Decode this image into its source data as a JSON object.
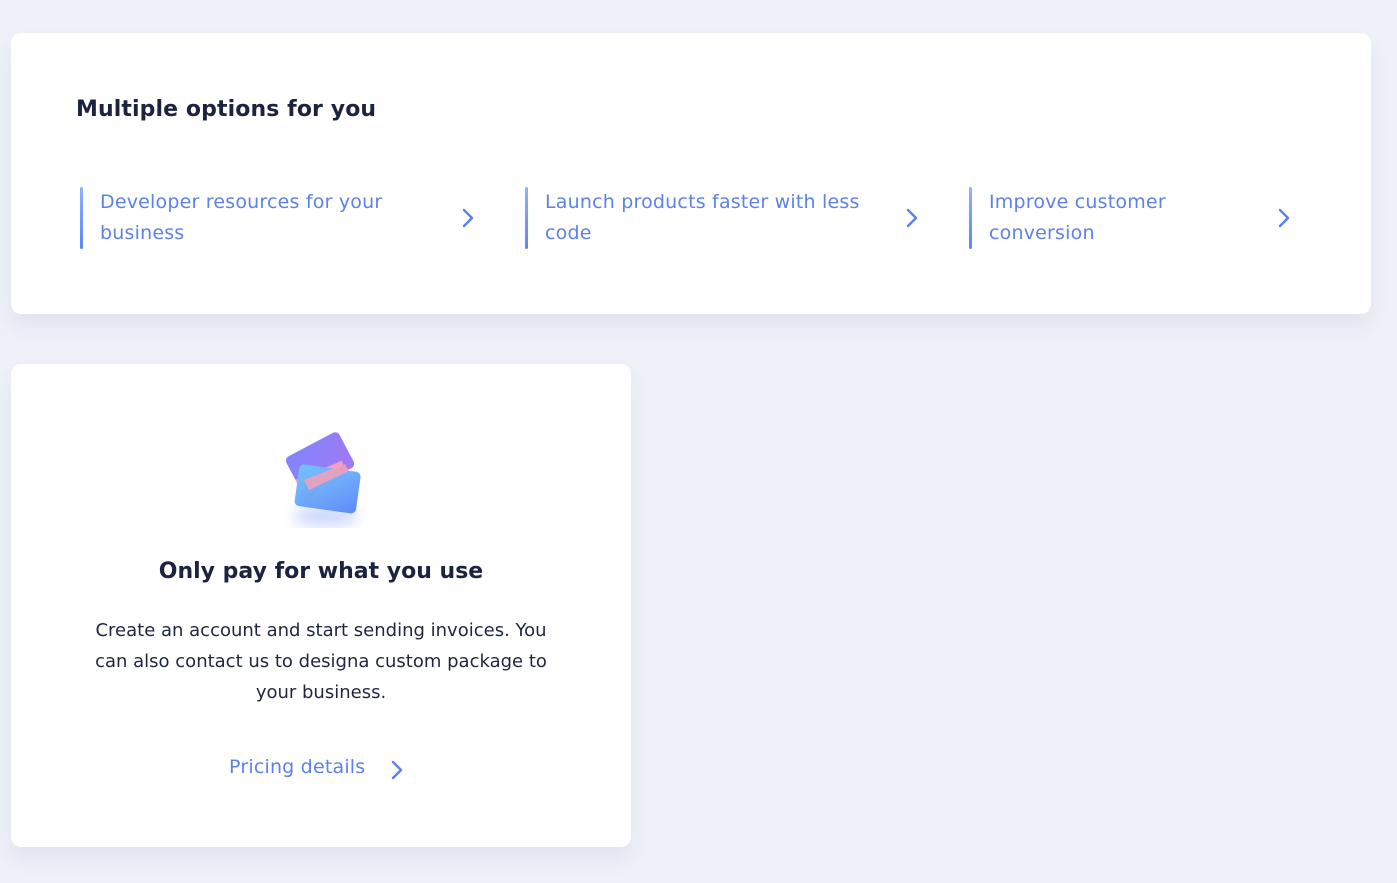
{
  "options_card": {
    "title": "Multiple options for you",
    "items": [
      {
        "label": "Developer resources for your business",
        "icon": "chevron-right-icon"
      },
      {
        "label": "Launch products faster with less code",
        "icon": "chevron-right-icon"
      },
      {
        "label": "Improve customer conversion",
        "icon": "chevron-right-icon"
      }
    ]
  },
  "pricing_card": {
    "illustration": "payment-cards-icon",
    "title": "Only pay for what you use",
    "body": "Create an account and start sending invoices. You can also contact us to designa custom package to your business.",
    "link_label": "Pricing details",
    "link_icon": "chevron-right-icon"
  },
  "colors": {
    "background": "#eef1f8",
    "card": "#ffffff",
    "accent": "#5d82e6",
    "heading": "#1c2340"
  }
}
